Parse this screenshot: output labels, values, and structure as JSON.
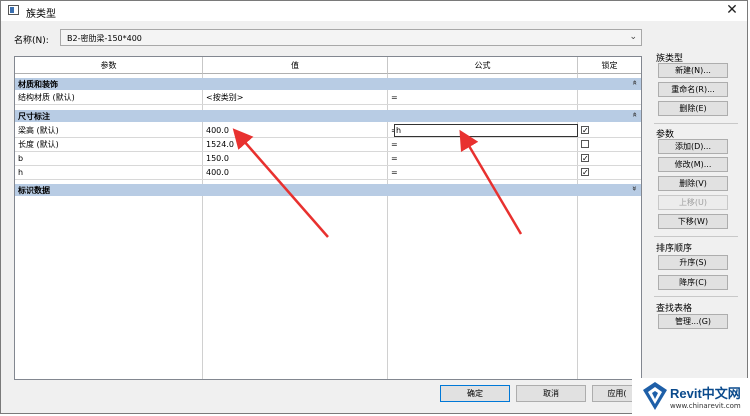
{
  "window": {
    "title": "族类型",
    "close": "✕"
  },
  "name_field": {
    "label": "名称(N):",
    "value": "B2-密肋梁-150*400"
  },
  "table": {
    "headers": [
      "参数",
      "值",
      "公式",
      "锁定"
    ],
    "groups": [
      {
        "title": "材质和装饰",
        "collapse": "»"
      },
      {
        "title": "尺寸标注",
        "collapse": "»"
      },
      {
        "title": "标识数据",
        "collapse": "»"
      }
    ],
    "rows": [
      {
        "param": "结构材质 (默认)",
        "value": "<按类别>",
        "formula": "=",
        "lock": ""
      },
      {
        "param": "梁高 (默认)",
        "value": "400.0",
        "formula": "=",
        "formula_edit": "h",
        "lock": "✓"
      },
      {
        "param": "长度 (默认)",
        "value": "1524.0",
        "formula": "=",
        "lock": ""
      },
      {
        "param": "b",
        "value": "150.0",
        "formula": "=",
        "lock": "✓"
      },
      {
        "param": "h",
        "value": "400.0",
        "formula": "=",
        "lock": "✓"
      }
    ]
  },
  "side": {
    "family_types": {
      "label": "族类型",
      "buttons": [
        "新建(N)...",
        "重命名(R)...",
        "删除(E)"
      ]
    },
    "params": {
      "label": "参数",
      "buttons": [
        "添加(D)...",
        "修改(M)...",
        "删除(V)",
        "上移(U)",
        "下移(W)"
      ]
    },
    "sort": {
      "label": "排序顺序",
      "buttons": [
        "升序(S)",
        "降序(C)"
      ]
    },
    "lookup": {
      "label": "查找表格",
      "buttons": [
        "管理...(G)"
      ]
    }
  },
  "bottom": {
    "ok": "确定",
    "cancel": "取消",
    "apply": "应用("
  },
  "watermark": {
    "brand": "Revit中文网",
    "url": "www.chinarevit.com"
  },
  "colors": {
    "group_header": "#b8cce4",
    "arrow": "#e8312f",
    "accent": "#0078d7"
  }
}
